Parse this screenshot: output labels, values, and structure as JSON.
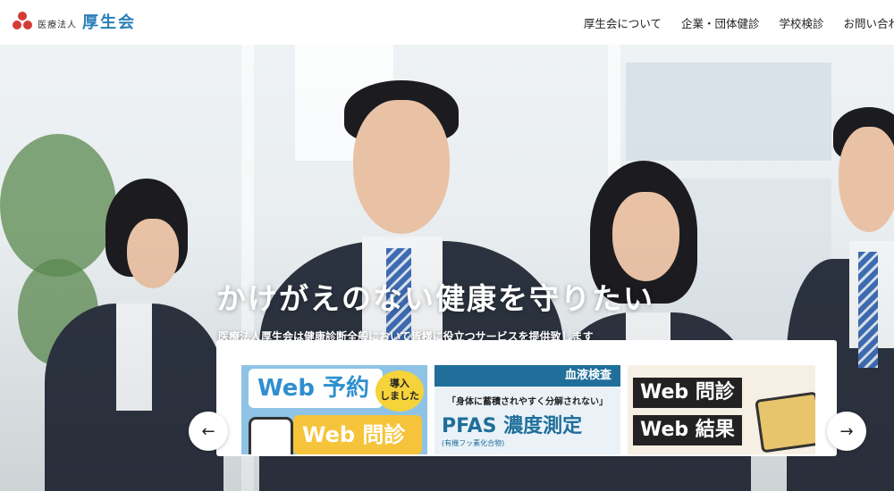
{
  "header": {
    "logo_sub": "医療法人",
    "logo_main": "厚生会",
    "nav": [
      "厚生会について",
      "企業・団体健診",
      "学校検診",
      "お問い合わ"
    ]
  },
  "hero": {
    "catch": "かけがえのない健康を守りたい",
    "sub": "医療法人厚生会は健康診断全般において皆様に役立つサービスを提供致します"
  },
  "cards": [
    {
      "title1": "Web 予約",
      "badge": "導入\nしました",
      "title2": "Web 問診"
    },
    {
      "bar": "血液検査",
      "quote": "「身体に蓄積されやすく分解されない」",
      "big": "PFAS 濃度測定",
      "small": "(有機フッ素化合物)"
    },
    {
      "line1": "Web 問診",
      "line2": "Web 結果"
    }
  ],
  "carousel": {
    "prev_icon": "arrow-left-icon",
    "next_icon": "arrow-right-icon"
  },
  "colors": {
    "brand_red": "#d63a35",
    "brand_blue": "#2b7fb9",
    "card_blue": "#1f6f9a",
    "card_yellow": "#f5c43a"
  }
}
